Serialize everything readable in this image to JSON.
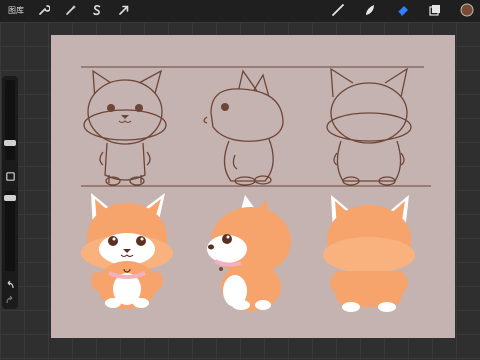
{
  "toolbar": {
    "gallery_label": "图库",
    "tools_left": [
      {
        "name": "wrench-icon"
      },
      {
        "name": "magic-wand-icon"
      },
      {
        "name": "selection-s-icon"
      },
      {
        "name": "transform-arrow-icon"
      }
    ],
    "tools_right": [
      {
        "name": "brush-icon"
      },
      {
        "name": "smudge-icon"
      },
      {
        "name": "eraser-icon",
        "active": true
      },
      {
        "name": "layers-icon"
      }
    ],
    "color_swatch": "#7a4a32",
    "accent": "#2f7fff"
  },
  "sidebar": {
    "undo_icon": "undo-icon",
    "redo_icon": "redo-icon",
    "modify_icon": "square-icon"
  },
  "canvas": {
    "background": "#c5b3b1",
    "sketch_stroke": "#6d4637",
    "fox_orange": "#f6a46b",
    "fox_white": "#ffffff",
    "collar": "#f3b0c0"
  }
}
